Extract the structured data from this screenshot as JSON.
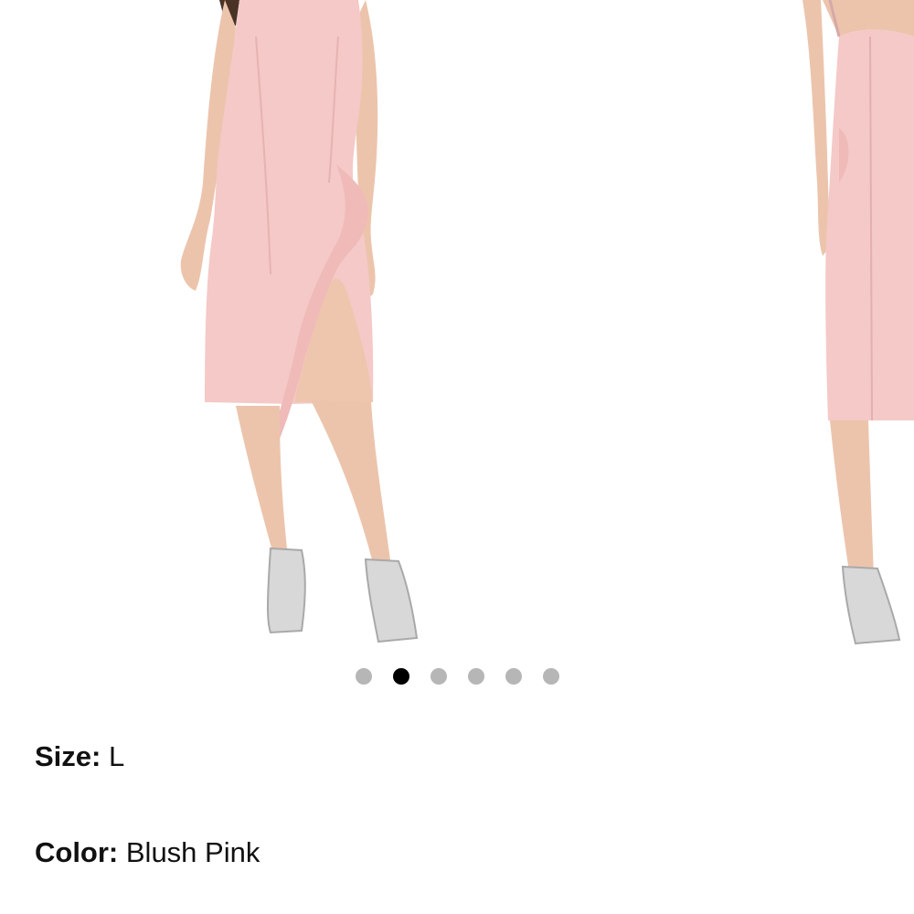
{
  "carousel": {
    "images": [
      {
        "icon": "dress-front-photo",
        "description": "model wearing dress, front view"
      },
      {
        "icon": "dress-back-photo",
        "description": "model wearing dress, back view"
      }
    ],
    "dots": [
      {
        "active": false
      },
      {
        "active": true
      },
      {
        "active": false
      },
      {
        "active": false
      },
      {
        "active": false
      },
      {
        "active": false
      }
    ],
    "current_index": 2,
    "total": 6
  },
  "product": {
    "size_label": "Size:",
    "size_value": "L",
    "color_label": "Color:",
    "color_value": "Blush Pink"
  },
  "colors": {
    "dress": "#f4c9c7",
    "skin": "#e9c3ab",
    "dot_active": "#000000",
    "dot_inactive": "#b6b6b6"
  }
}
